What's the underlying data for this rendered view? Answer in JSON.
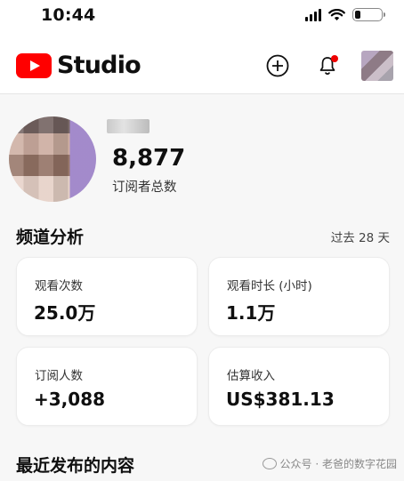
{
  "status_bar": {
    "time": "10:44"
  },
  "header": {
    "logo_text": "Studio",
    "create_icon": "plus-circle-icon",
    "bell_icon": "bell-icon"
  },
  "channel": {
    "subscribers": "8,877",
    "subscribers_label": "订阅者总数"
  },
  "analytics": {
    "title": "频道分析",
    "period": "过去 28 天",
    "cards": [
      {
        "label": "观看次数",
        "value": "25.0万"
      },
      {
        "label": "观看时长 (小时)",
        "value": "1.1万"
      },
      {
        "label": "订阅人数",
        "value": "+3,088"
      },
      {
        "label": "估算收入",
        "value": "US$381.13"
      }
    ]
  },
  "recent": {
    "title": "最近发布的内容"
  },
  "watermark": {
    "text": "公众号 · 老爸的数字花园"
  },
  "colors": {
    "brand_red": "#ff0000",
    "notification_dot": "#ee0000"
  }
}
